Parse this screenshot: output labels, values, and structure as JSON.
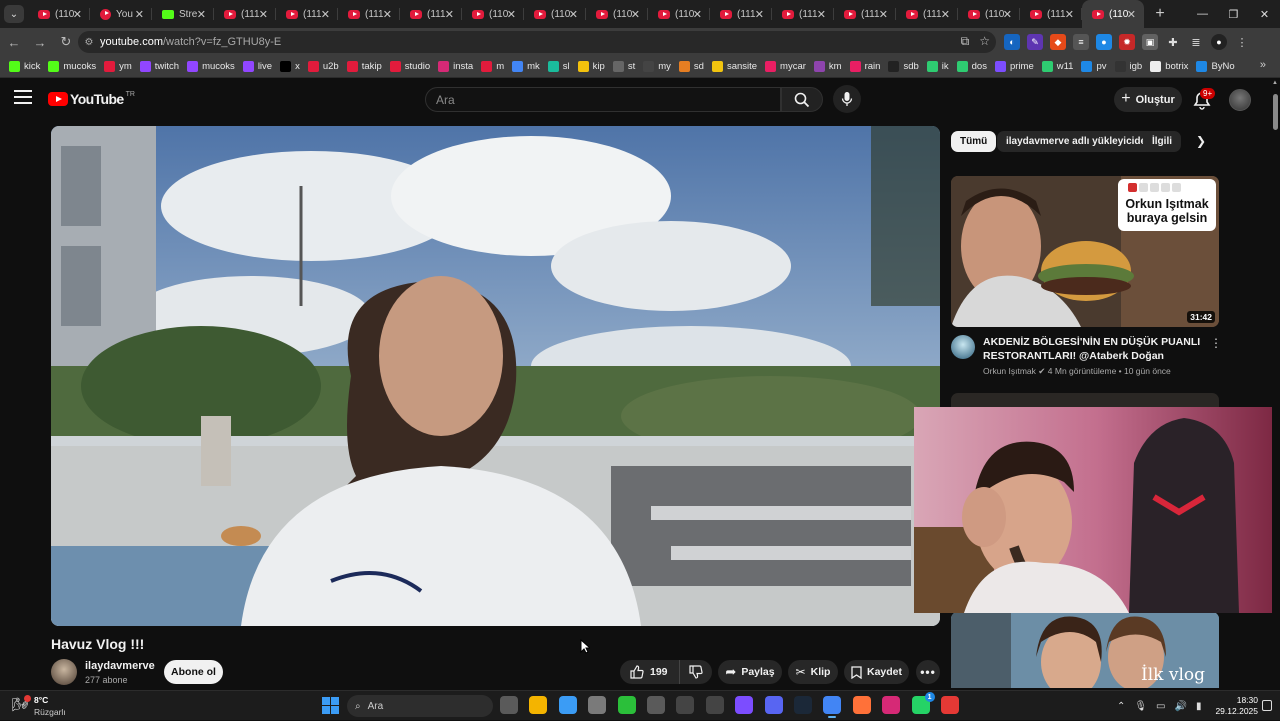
{
  "browser": {
    "tabs": [
      {
        "title": "(110",
        "icon": "youtube-icon"
      },
      {
        "title": "You",
        "icon": "youtube-round-icon"
      },
      {
        "title": "Stre",
        "icon": "kick-icon"
      },
      {
        "title": "(111",
        "icon": "youtube-icon"
      },
      {
        "title": "(111",
        "icon": "youtube-icon"
      },
      {
        "title": "(111",
        "icon": "youtube-icon"
      },
      {
        "title": "(111",
        "icon": "youtube-icon"
      },
      {
        "title": "(110",
        "icon": "youtube-icon"
      },
      {
        "title": "(110",
        "icon": "youtube-icon"
      },
      {
        "title": "(110",
        "icon": "youtube-icon"
      },
      {
        "title": "(110",
        "icon": "youtube-icon"
      },
      {
        "title": "(111",
        "icon": "youtube-icon"
      },
      {
        "title": "(111",
        "icon": "youtube-icon"
      },
      {
        "title": "(111",
        "icon": "youtube-icon"
      },
      {
        "title": "(111",
        "icon": "youtube-icon"
      },
      {
        "title": "(110",
        "icon": "youtube-icon"
      },
      {
        "title": "(111",
        "icon": "youtube-icon"
      },
      {
        "title": "(110",
        "icon": "youtube-icon",
        "active": true
      }
    ],
    "close_glyph": "✕",
    "new_tab_glyph": "+",
    "url_host": "youtube.com",
    "url_path": "/watch?v=fz_GTHU8y-E",
    "bookmarks": [
      {
        "label": "kick",
        "color": "#53fc18"
      },
      {
        "label": "mucoks",
        "color": "#53fc18"
      },
      {
        "label": "ym",
        "color": "#e21b3c"
      },
      {
        "label": "twitch",
        "color": "#9146ff"
      },
      {
        "label": "mucoks",
        "color": "#9146ff"
      },
      {
        "label": "live",
        "color": "#9146ff"
      },
      {
        "label": "x",
        "color": "#000000"
      },
      {
        "label": "u2b",
        "color": "#e21b3c"
      },
      {
        "label": "takip",
        "color": "#e21b3c"
      },
      {
        "label": "studio",
        "color": "#e21b3c"
      },
      {
        "label": "insta",
        "color": "#d62976"
      },
      {
        "label": "m",
        "color": "#e21b3c"
      },
      {
        "label": "mk",
        "color": "#4285f4"
      },
      {
        "label": "sl",
        "color": "#1abc9c"
      },
      {
        "label": "kip",
        "color": "#f4c20d"
      },
      {
        "label": "st",
        "color": "#666666"
      },
      {
        "label": "my",
        "color": "#444444"
      },
      {
        "label": "sd",
        "color": "#e67e22"
      },
      {
        "label": "sansite",
        "color": "#f1c40f"
      },
      {
        "label": "mycar",
        "color": "#e91e63"
      },
      {
        "label": "km",
        "color": "#8e44ad"
      },
      {
        "label": "rain",
        "color": "#e91e63"
      },
      {
        "label": "sdb",
        "color": "#222222"
      },
      {
        "label": "ik",
        "color": "#2ecc71"
      },
      {
        "label": "dos",
        "color": "#2ecc71"
      },
      {
        "label": "prime",
        "color": "#7c4dff"
      },
      {
        "label": "w11",
        "color": "#2ecc71"
      },
      {
        "label": "pv",
        "color": "#1e88e5"
      },
      {
        "label": "igb",
        "color": "#333333"
      },
      {
        "label": "botrix",
        "color": "#eeeeee"
      },
      {
        "label": "ByNo",
        "color": "#1e88e5"
      }
    ]
  },
  "youtube": {
    "logo_text": "YouTube",
    "logo_country": "TR",
    "search_placeholder": "Ara",
    "create_label": "Oluştur",
    "notification_count": "9+",
    "video_title": "Havuz Vlog !!!",
    "channel_name": "ilaydavmerve",
    "channel_subs": "277 abone",
    "subscribe_label": "Abone ol",
    "like_count": "199",
    "share_label": "Paylaş",
    "clip_label": "Klip",
    "save_label": "Kaydet",
    "chips": [
      {
        "label": "Tümü",
        "selected": true
      },
      {
        "label": "ilaydavmerve adlı yükleyiciden",
        "selected": false
      },
      {
        "label": "İlgili",
        "selected": false
      }
    ],
    "recommendations": [
      {
        "title": "AKDENİZ BÖLGESİ'NİN EN DÜŞÜK PUANLI RESTORANTLARI! @Ataberk Doğan @Tolun...",
        "channel": "Orkun Işıtmak",
        "meta": "4 Mn görüntüleme • 10 gün önce",
        "duration": "31:42",
        "thumb_text": "Orkun Işıtmak buraya gelsin",
        "rating": 1,
        "rating_max": 5
      },
      {
        "title": "",
        "thumb_text": "İlk vlog"
      }
    ]
  },
  "taskbar": {
    "weather_temp": "8°C",
    "weather_desc": "Rüzgarlı",
    "search_placeholder": "Ara",
    "time": "18:30",
    "date": "29.12.2025",
    "whatsapp_badge": "1",
    "apps": [
      {
        "name": "task-view-icon",
        "color": "#5a5a5a"
      },
      {
        "name": "file-explorer-icon",
        "color": "#f4b400"
      },
      {
        "name": "store-icon",
        "color": "#3b9cf5"
      },
      {
        "name": "settings-icon",
        "color": "#7a7a7a"
      },
      {
        "name": "razer-icon",
        "color": "#2bbf3a"
      },
      {
        "name": "xbox-icon",
        "color": "#5a5a5a"
      },
      {
        "name": "epic-icon",
        "color": "#444444"
      },
      {
        "name": "vpn-icon",
        "color": "#444444"
      },
      {
        "name": "app-purple-icon",
        "color": "#7c4dff"
      },
      {
        "name": "discord-icon",
        "color": "#5865f2"
      },
      {
        "name": "steam-icon",
        "color": "#1b2838"
      },
      {
        "name": "chrome-icon",
        "color": "#4285f4"
      },
      {
        "name": "firefox-icon",
        "color": "#ff7139"
      },
      {
        "name": "instagram-icon",
        "color": "#d62976"
      },
      {
        "name": "whatsapp-icon",
        "color": "#25d366"
      },
      {
        "name": "app-red-icon",
        "color": "#e53935"
      }
    ]
  }
}
